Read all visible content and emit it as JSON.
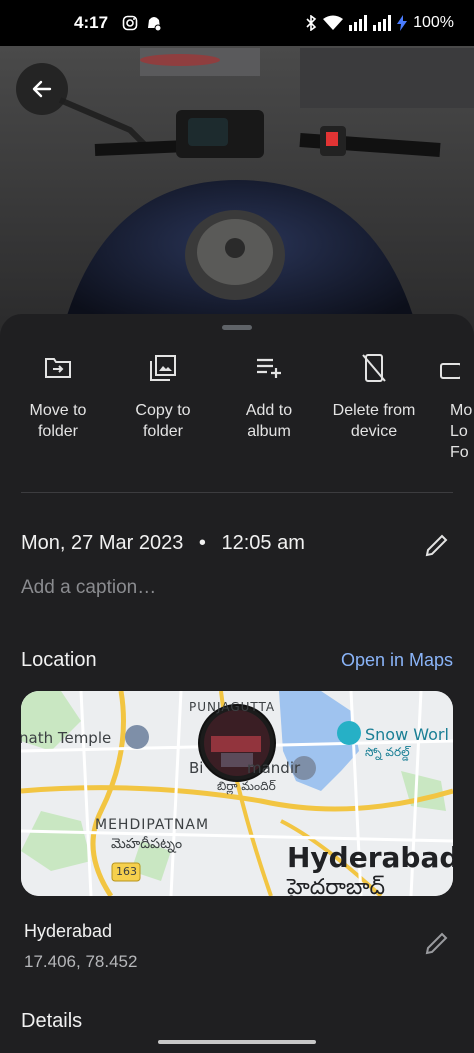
{
  "status_bar": {
    "time": "4:17",
    "battery": "100%",
    "icons": [
      "instagram-icon",
      "notification-icon",
      "bluetooth-icon",
      "wifi-icon",
      "signal-icon",
      "signal-icon",
      "charging-icon"
    ]
  },
  "actions": [
    {
      "icon": "move-to-folder-icon",
      "label": "Move to\nfolder"
    },
    {
      "icon": "copy-to-folder-icon",
      "label": "Copy to\nfolder"
    },
    {
      "icon": "add-to-album-icon",
      "label": "Add to\nalbum"
    },
    {
      "icon": "delete-from-device-icon",
      "label": "Delete from\ndevice"
    },
    {
      "icon": "move-to-locked-folder-icon",
      "label": "Mo\nLo\nFo"
    }
  ],
  "info": {
    "date": "Mon, 27 Mar 2023",
    "separator": "•",
    "time": "12:05 am",
    "caption_placeholder": "Add a caption…"
  },
  "location": {
    "title": "Location",
    "open_maps": "Open in Maps",
    "place_name": "Hyderabad",
    "coords": "17.406, 78.452",
    "map_labels": {
      "temple": "nath Temple",
      "punjagutta": "PUNJAGUTTA",
      "birla": "Bi",
      "birla2": "mandir",
      "birla_telugu": "బిర్లా మందిర్",
      "snow": "Snow Worl",
      "snow_telugu": "స్నో వరల్డ్",
      "mehdipatnam": "MEHDIPATNAM",
      "mehdipatnam_telugu": "మెహదీపట్నం",
      "road": "163",
      "city": "Hyderabad",
      "city_telugu": "హైదరాబాద్"
    }
  },
  "details": {
    "title": "Details"
  }
}
